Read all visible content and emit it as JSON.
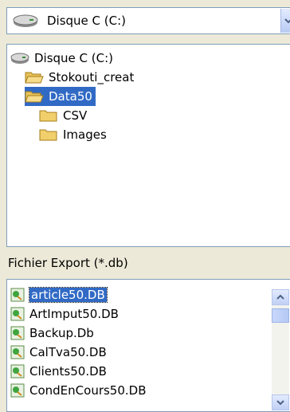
{
  "drive_selector": {
    "value": "Disque C (C:)",
    "icon": "hard-drive-icon"
  },
  "folder_tree": {
    "items": [
      {
        "label": "Disque C (C:)",
        "icon": "hard-drive-icon"
      },
      {
        "label": "Stokouti_creat",
        "icon": "open-folder-icon"
      },
      {
        "label": "Data50",
        "icon": "open-folder-icon",
        "selected": true
      },
      {
        "label": "CSV",
        "icon": "folder-icon"
      },
      {
        "label": "Images",
        "icon": "folder-icon"
      }
    ]
  },
  "file_type_label": "Fichier Export (*.db)",
  "file_list": {
    "items": [
      {
        "label": "article50.DB",
        "selected": true
      },
      {
        "label": "ArtImput50.DB"
      },
      {
        "label": "Backup.Db"
      },
      {
        "label": "CalTva50.DB"
      },
      {
        "label": "Clients50.DB"
      },
      {
        "label": "CondEnCours50.DB"
      }
    ]
  },
  "colors": {
    "selection": "#316ac5",
    "border": "#7f9db9",
    "background": "#ece9d8"
  }
}
